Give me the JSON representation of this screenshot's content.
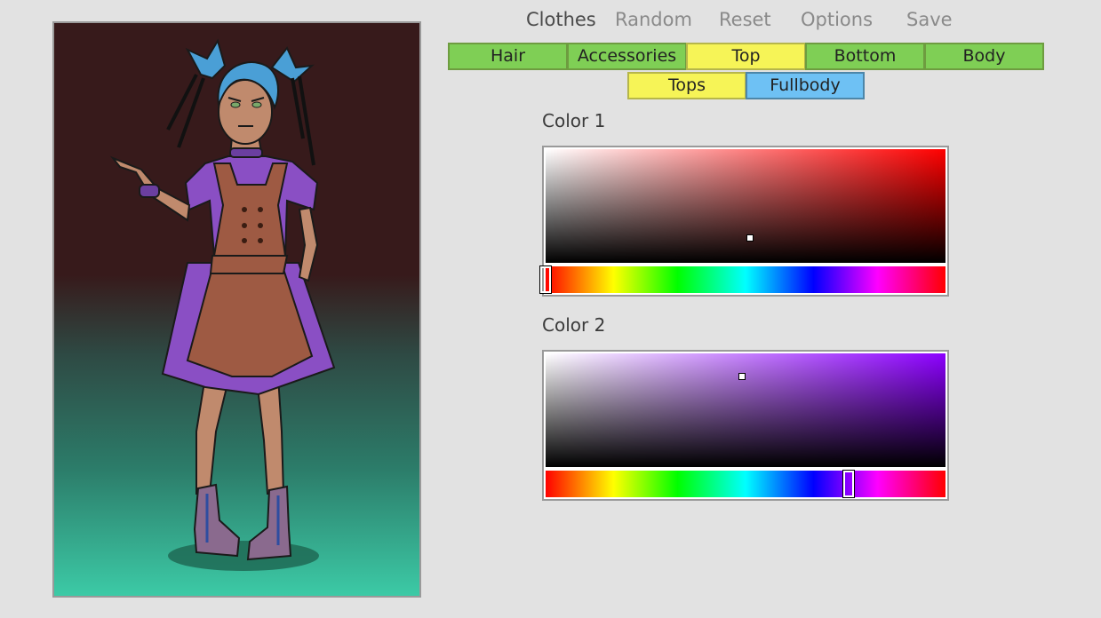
{
  "menu": {
    "clothes": "Clothes",
    "random": "Random",
    "reset": "Reset",
    "options": "Options",
    "save": "Save"
  },
  "categories": [
    "Hair",
    "Accessories",
    "Top",
    "Bottom",
    "Body"
  ],
  "active_category": "Top",
  "subcategories": [
    "Tops",
    "Fullbody"
  ],
  "active_subcategory": "Fullbody",
  "colors": [
    {
      "label": "Color 1",
      "hue_deg": 0,
      "saturation": 0.51,
      "value": 0.22,
      "base_color": "#ff0000"
    },
    {
      "label": "Color 2",
      "hue_deg": 273,
      "saturation": 0.49,
      "value": 0.8,
      "base_color": "#8c00ff"
    }
  ],
  "palette": {
    "tab_green": "#7fcf55",
    "tab_yellow": "#f6f457",
    "tab_blue": "#6ec1f4",
    "background": "#e2e2e2"
  }
}
